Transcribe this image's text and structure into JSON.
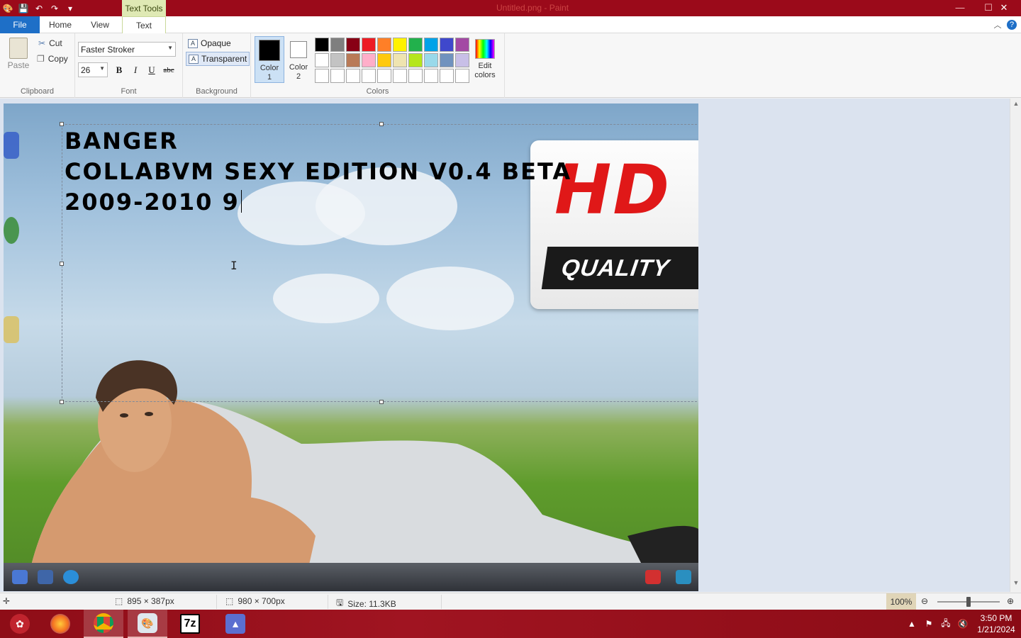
{
  "titlebar": {
    "context_tab": "Text Tools",
    "title": "Untitled.png - Paint",
    "minimize": "—",
    "maximize": "☐",
    "close": "✕"
  },
  "tabs": [
    {
      "label": "File"
    },
    {
      "label": "Home"
    },
    {
      "label": "View"
    },
    {
      "label": "Text"
    }
  ],
  "ribbon": {
    "clipboard": {
      "paste": "Paste",
      "cut": "Cut",
      "copy": "Copy",
      "label": "Clipboard"
    },
    "font": {
      "family": "Faster Stroker",
      "size": "26",
      "bold": "B",
      "italic": "I",
      "underline": "U",
      "strike": "abc",
      "label": "Font"
    },
    "background": {
      "opaque": "Opaque",
      "transparent": "Transparent",
      "label": "Background"
    },
    "colors": {
      "color1_label_a": "Color",
      "color1_label_b": "1",
      "color2_label_a": "Color",
      "color2_label_b": "2",
      "color1_value": "#000000",
      "color2_value": "#ffffff",
      "edit_a": "Edit",
      "edit_b": "colors",
      "label": "Colors",
      "palette": [
        "#000000",
        "#7f7f7f",
        "#880015",
        "#ed1c24",
        "#ff7f27",
        "#fff200",
        "#22b14c",
        "#00a2e8",
        "#3f48cc",
        "#a349a4",
        "#ffffff",
        "#c3c3c3",
        "#b97a57",
        "#ffaec9",
        "#ffc90e",
        "#efe4b0",
        "#b5e61d",
        "#99d9ea",
        "#7092be",
        "#c8bfe7",
        "#ffffff",
        "#ffffff",
        "#ffffff",
        "#ffffff",
        "#ffffff",
        "#ffffff",
        "#ffffff",
        "#ffffff",
        "#ffffff",
        "#ffffff"
      ]
    }
  },
  "canvas": {
    "text_lines": [
      "BANGER",
      "COLLABVM SEXY EDITION V0.4 BETA",
      "2009-2010 9"
    ],
    "banner_hd": "HD",
    "banner_quality": "QUALITY"
  },
  "statusbar": {
    "selection": "895 × 387px",
    "canvas_size": "980 × 700px",
    "file_size": "Size: 11.3KB",
    "zoom": "100%"
  },
  "taskbar": {
    "time": "3:50 PM",
    "date": "1/21/2024",
    "app_7z": "7z"
  }
}
